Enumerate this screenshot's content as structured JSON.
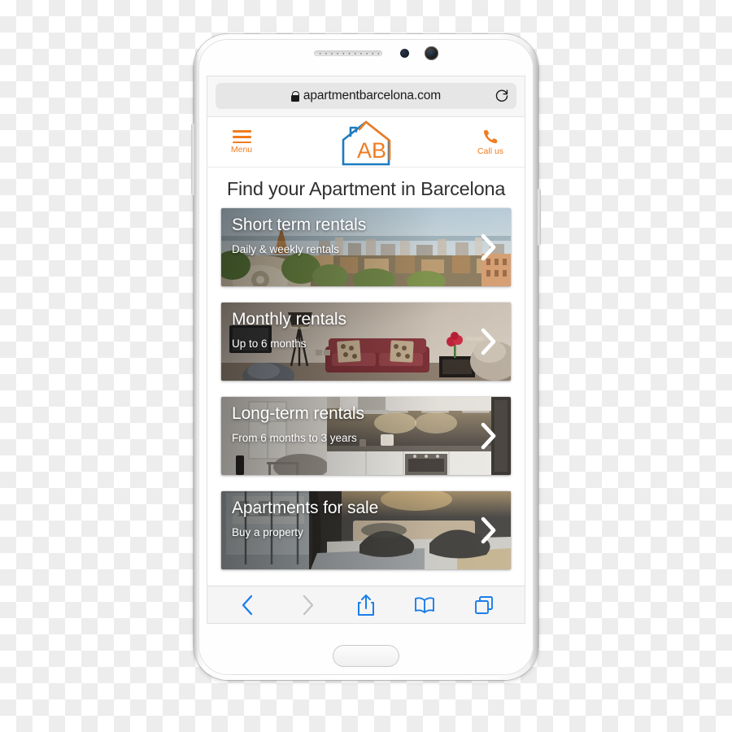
{
  "browser": {
    "url_bar": {
      "lock_icon": "lock-icon",
      "host": "apartmentbarcelona.com",
      "reload_icon": "reload-icon"
    },
    "toolbar": {
      "back_icon": "chevron-left-icon",
      "forward_icon": "chevron-right-icon",
      "share_icon": "share-icon",
      "bookmarks_icon": "book-icon",
      "tabs_icon": "tabs-icon"
    }
  },
  "site": {
    "header": {
      "menu_icon": "hamburger-icon",
      "menu_label": "Menu",
      "logo_icon": "house-logo-icon",
      "logo_text": "AB",
      "call_icon": "phone-icon",
      "call_label": "Call us"
    },
    "hero": {
      "title": "Find your Apartment in Barcelona"
    },
    "cards": [
      {
        "title": "Short term rentals",
        "subtitle": "Daily & weekly rentals",
        "chevron_icon": "chevron-right-icon",
        "photo": "barcelona-park-guell-skyline"
      },
      {
        "title": "Monthly rentals",
        "subtitle": "Up to 6 months",
        "chevron_icon": "chevron-right-icon",
        "photo": "living-room-red-sofa"
      },
      {
        "title": "Long-term rentals",
        "subtitle": "From 6 months to 3 years",
        "chevron_icon": "chevron-right-icon",
        "photo": "modern-kitchen-interior"
      },
      {
        "title": "Apartments for sale",
        "subtitle": "Buy a property",
        "chevron_icon": "chevron-right-icon",
        "photo": "bedroom-dark-pillows"
      }
    ]
  },
  "colors": {
    "brand_orange": "#f07c1f",
    "brand_blue": "#1c7cc0",
    "toolbar_blue": "#1b7eea"
  },
  "device": {
    "earpiece": "earpiece-speaker",
    "proximity_sensor": "proximity-sensor-icon",
    "front_camera": "front-camera-icon",
    "home_button": "home-button"
  }
}
